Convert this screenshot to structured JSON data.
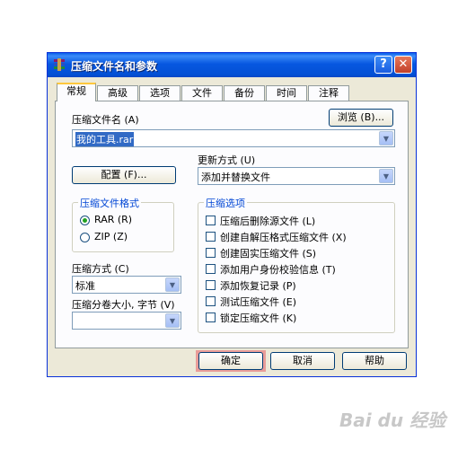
{
  "window": {
    "title": "压缩文件名和参数",
    "help": "?",
    "close": "✕"
  },
  "tabs": [
    {
      "label": "常规"
    },
    {
      "label": "高级"
    },
    {
      "label": "选项"
    },
    {
      "label": "文件"
    },
    {
      "label": "备份"
    },
    {
      "label": "时间"
    },
    {
      "label": "注释"
    }
  ],
  "general": {
    "archive_name_label": "压缩文件名 (A)",
    "browse_button": "浏览 (B)...",
    "archive_name_value": "我的工具.rar",
    "update_mode_label": "更新方式 (U)",
    "update_mode_value": "添加并替换文件",
    "profile_button": "配置 (F)...",
    "format_group": "压缩文件格式",
    "format_rar": "RAR (R)",
    "format_zip": "ZIP (Z)",
    "options_group": "压缩选项",
    "options": [
      {
        "label": "压缩后删除源文件 (L)"
      },
      {
        "label": "创建自解压格式压缩文件 (X)"
      },
      {
        "label": "创建固实压缩文件 (S)"
      },
      {
        "label": "添加用户身份校验信息 (T)"
      },
      {
        "label": "添加恢复记录 (P)"
      },
      {
        "label": "测试压缩文件 (E)"
      },
      {
        "label": "锁定压缩文件 (K)"
      }
    ],
    "method_label": "压缩方式 (C)",
    "method_value": "标准",
    "split_label": "压缩分卷大小, 字节 (V)",
    "split_value": ""
  },
  "footer": {
    "ok": "确定",
    "cancel": "取消",
    "help": "帮助"
  },
  "watermark": "Bai du 经验"
}
